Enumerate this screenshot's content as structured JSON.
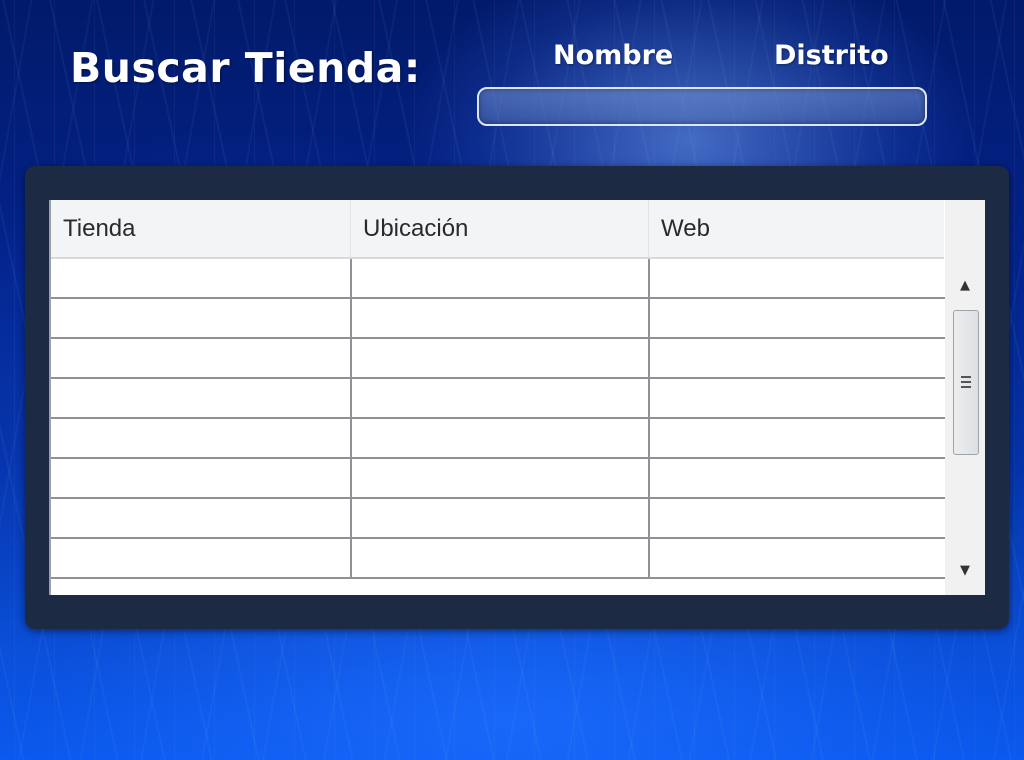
{
  "page": {
    "title": "Buscar Tienda:"
  },
  "search": {
    "label_nombre": "Nombre",
    "label_distrito": "Distrito",
    "value": "",
    "placeholder": ""
  },
  "table": {
    "columns": [
      "Tienda",
      "Ubicación",
      "Web"
    ],
    "rows": [
      [
        "",
        "",
        ""
      ],
      [
        "",
        "",
        ""
      ],
      [
        "",
        "",
        ""
      ],
      [
        "",
        "",
        ""
      ],
      [
        "",
        "",
        ""
      ],
      [
        "",
        "",
        ""
      ],
      [
        "",
        "",
        ""
      ],
      [
        "",
        "",
        ""
      ]
    ]
  },
  "scrollbar": {
    "up_icon": "arrow-up-icon",
    "down_icon": "arrow-down-icon",
    "thumb_icon": "grip-icon"
  },
  "colors": {
    "panel": "#1d2a44",
    "background": "#0432a8"
  }
}
